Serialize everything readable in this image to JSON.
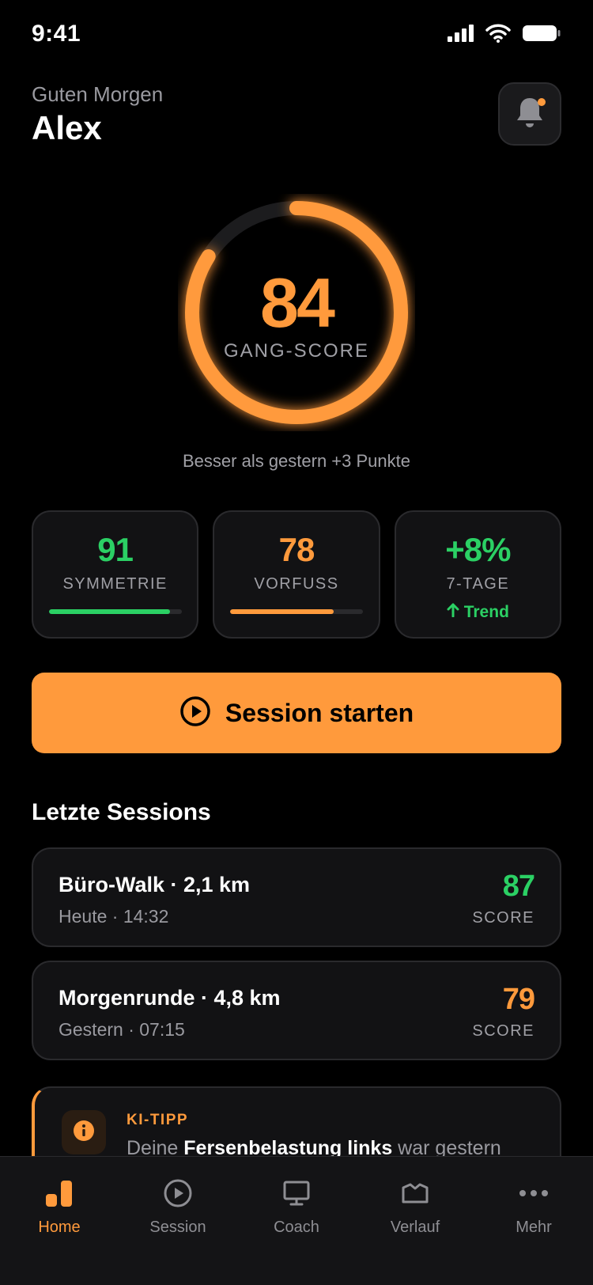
{
  "status_bar": {
    "time": "9:41"
  },
  "header": {
    "greeting": "Guten Morgen",
    "name": "Alex"
  },
  "score": {
    "value": "84",
    "fraction": 0.84,
    "label": "GANG-SCORE",
    "subtitle": "Besser als gestern +3 Punkte"
  },
  "metrics": [
    {
      "value": "91",
      "label": "SYMMETRIE",
      "progress": 0.91,
      "color": "#2bd064"
    },
    {
      "value": "78",
      "label": "VORFUSS",
      "progress": 0.78,
      "color": "#ff9a3c"
    },
    {
      "value": "+8%",
      "label": "7-TAGE",
      "trend": "Trend",
      "color": "#2bd064"
    }
  ],
  "start_button": {
    "label": "Session starten"
  },
  "sessions": {
    "title": "Letzte Sessions",
    "items": [
      {
        "name": "Büro-Walk · 2,1 km",
        "meta": "Heute · 14:32",
        "score": "87",
        "score_label": "SCORE",
        "color": "#2bd064"
      },
      {
        "name": "Morgenrunde · 4,8 km",
        "meta": "Gestern · 07:15",
        "score": "79",
        "score_label": "SCORE",
        "color": "#ff9a3c"
      }
    ]
  },
  "tip": {
    "title": "KI-TIPP",
    "text_before": "Deine ",
    "text_bold": "Fersenbelastung links",
    "text_after": " war gestern"
  },
  "tabs": [
    {
      "label": "Home",
      "icon": "home-bars-icon",
      "active": true
    },
    {
      "label": "Session",
      "icon": "play-circle-icon"
    },
    {
      "label": "Coach",
      "icon": "monitor-icon"
    },
    {
      "label": "Verlauf",
      "icon": "map-icon"
    },
    {
      "label": "Mehr",
      "icon": "more-dots-icon"
    }
  ],
  "colors": {
    "accent": "#ff9a3c",
    "green": "#2bd064",
    "background": "#000000",
    "card": "#121214"
  }
}
